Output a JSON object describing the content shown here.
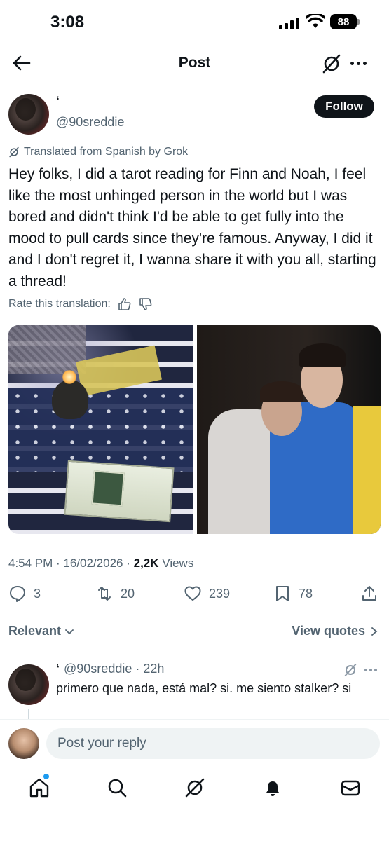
{
  "status_bar": {
    "time": "3:08",
    "battery": "88"
  },
  "header": {
    "title": "Post"
  },
  "post": {
    "author_name": "‘",
    "author_handle": "@90sreddie",
    "follow_label": "Follow",
    "translated_note": "Translated from Spanish by Grok",
    "text": "Hey folks, I did a tarot reading for Finn and Noah, I feel like the most unhinged person in the world but I was bored and didn't think I'd be able to get fully into the mood to pull cards since they're famous. Anyway, I did it and I don't regret it, I wanna share it with you all, starting a thread!",
    "rate_label": "Rate this translation:",
    "time": "4:54 PM",
    "date": "16/02/2026",
    "views_count": "2,2K",
    "views_label": "Views",
    "stats": {
      "replies": "3",
      "reposts": "20",
      "likes": "239",
      "bookmarks": "78"
    },
    "media": [
      {
        "description": "tarot setup with candle on flag"
      },
      {
        "description": "two people posing"
      }
    ]
  },
  "filter": {
    "sort_label": "Relevant",
    "view_quotes_label": "View quotes"
  },
  "reply": {
    "author_name": "‘",
    "handle": "@90sreddie",
    "time": "22h",
    "text": "primero que nada, está mal? si. me siento stalker? si"
  },
  "composer": {
    "placeholder": "Post your reply"
  },
  "tabs": [
    "home-icon",
    "search-icon",
    "grok-icon",
    "notifications-icon",
    "messages-icon"
  ]
}
